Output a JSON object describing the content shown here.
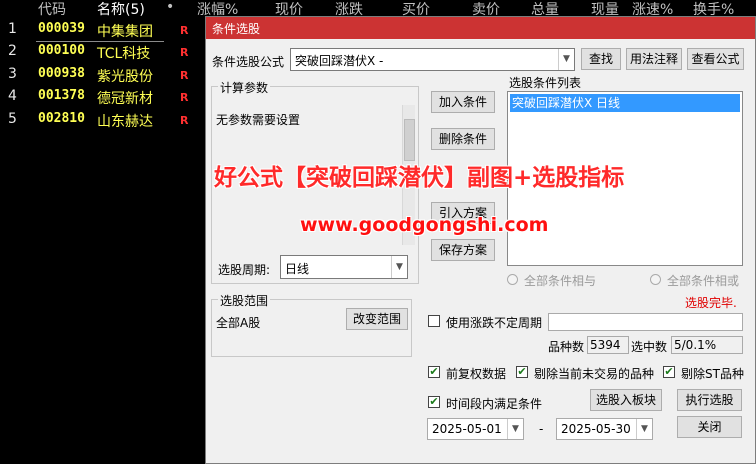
{
  "list_header": {
    "cols": [
      "代码",
      "名称(5)",
      "•",
      "涨幅%",
      "现价",
      "涨跌",
      "买价",
      "卖价",
      "总量",
      "现量",
      "涨速%",
      "换手%"
    ]
  },
  "stocks": [
    {
      "idx": "1",
      "code": "000039",
      "name": "中集集团",
      "flag": "R"
    },
    {
      "idx": "2",
      "code": "000100",
      "name": "TCL科技",
      "flag": "R"
    },
    {
      "idx": "3",
      "code": "000938",
      "name": "紫光股份",
      "flag": "R"
    },
    {
      "idx": "4",
      "code": "001378",
      "name": "德冠新材",
      "flag": "R"
    },
    {
      "idx": "5",
      "code": "002810",
      "name": "山东赫达",
      "flag": "R"
    }
  ],
  "dialog": {
    "title": "条件选股",
    "formula_label": "条件选股公式",
    "formula_value": "突破回踩潜伏X -",
    "find_btn": "查找",
    "usage_btn": "用法注释",
    "view_btn": "查看公式",
    "params_group": "计算参数",
    "params_text": "无参数需要设置",
    "period_label": "选股周期:",
    "period_value": "日线",
    "add_btn": "加入条件",
    "delete_btn": "删除条件",
    "import_btn": "引入方案",
    "save_btn": "保存方案",
    "cond_list_label": "选股条件列表",
    "cond_items": [
      "突破回踩潜伏X  日线"
    ],
    "radio_and": "全部条件相与",
    "radio_or": "全部条件相或",
    "status": "选股完毕.",
    "range_group": "选股范围",
    "range_value": "全部A股",
    "change_range_btn": "改变范围",
    "use_undetermined": "使用涨跌不定周期",
    "count_label": "品种数",
    "count_value": "5394",
    "selected_label": "选中数",
    "selected_value": "5/0.1%",
    "pre_adjust": "前复权数据",
    "exclude_no_trade": "剔除当前未交易的品种",
    "exclude_st": "剔除ST品种",
    "time_range": "时间段内满足条件",
    "to_block_btn": "选股入板块",
    "run_btn": "执行选股",
    "date_from": "2025-05-01",
    "date_sep": "-",
    "date_to": "2025-05-30",
    "close_btn": "关闭"
  },
  "overlay": {
    "headline": "好公式【突破回踩潜伏】副图+选股指标",
    "url": "www.goodgongshi.com"
  },
  "colors": {
    "title_bar": "#cc3333",
    "selection": "#3399ff",
    "stock_code": "#ffff54",
    "flag": "#ff3030",
    "status": "#e00000"
  }
}
